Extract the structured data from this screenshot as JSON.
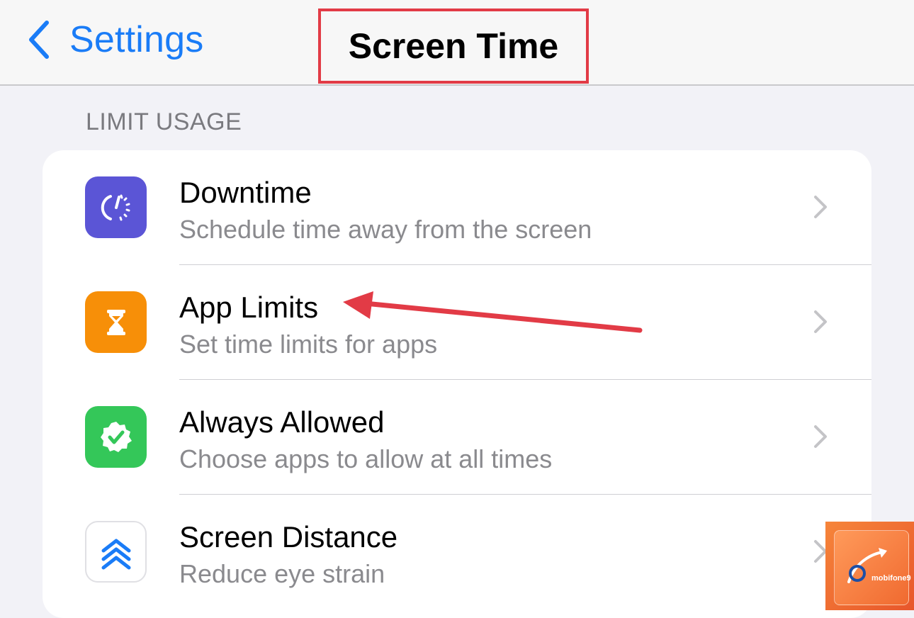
{
  "nav": {
    "back_label": "Settings",
    "title": "Screen Time"
  },
  "section": {
    "header": "LIMIT USAGE"
  },
  "rows": [
    {
      "title": "Downtime",
      "subtitle": "Schedule time away from the screen",
      "icon": "downtime-icon",
      "icon_color": "#5b55d6"
    },
    {
      "title": "App Limits",
      "subtitle": "Set time limits for apps",
      "icon": "hourglass-icon",
      "icon_color": "#f78f08"
    },
    {
      "title": "Always Allowed",
      "subtitle": "Choose apps to allow at all times",
      "icon": "checkmark-badge-icon",
      "icon_color": "#34c759"
    },
    {
      "title": "Screen Distance",
      "subtitle": "Reduce eye strain",
      "icon": "double-chevron-up-icon",
      "icon_color": "#ffffff"
    }
  ],
  "colors": {
    "accent": "#1a7cf7",
    "highlight": "#e23b46"
  },
  "watermark": {
    "brand": "mobifone9"
  }
}
